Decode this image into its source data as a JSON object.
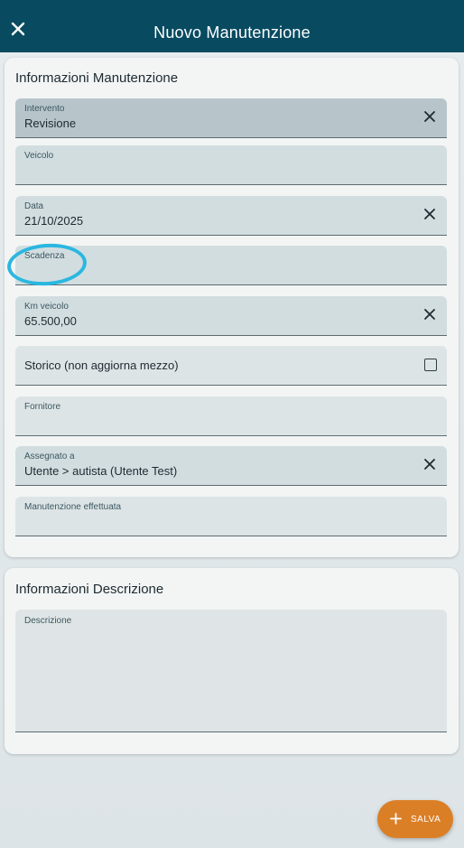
{
  "header": {
    "title": "Nuovo Manutenzione",
    "close_icon": "close-icon"
  },
  "sections": {
    "maintenance": {
      "title": "Informazioni Manutenzione",
      "fields": {
        "intervento": {
          "label": "Intervento",
          "value": "Revisione"
        },
        "veicolo": {
          "label": "Veicolo",
          "value": ""
        },
        "data": {
          "label": "Data",
          "value": "21/10/2025"
        },
        "scadenza": {
          "label": "Scadenza",
          "value": ""
        },
        "km_veicolo": {
          "label": "Km veicolo",
          "value": "65.500,00"
        },
        "storico": {
          "label": "Storico (non aggiorna mezzo)",
          "checked": false
        },
        "fornitore": {
          "label": "Fornitore",
          "value": ""
        },
        "assegnato": {
          "label": "Assegnato a",
          "value": "Utente > autista (Utente Test)"
        },
        "effettuata": {
          "label": "Manutenzione effettuata",
          "value": ""
        }
      }
    },
    "description": {
      "title": "Informazioni Descrizione",
      "fields": {
        "descrizione": {
          "label": "Descrizione",
          "value": ""
        }
      }
    }
  },
  "fab": {
    "label": "SALVA",
    "icon": "plus-icon"
  },
  "colors": {
    "header": "#084b61",
    "fab": "#db7f27",
    "highlight": "#2ab7e0"
  }
}
